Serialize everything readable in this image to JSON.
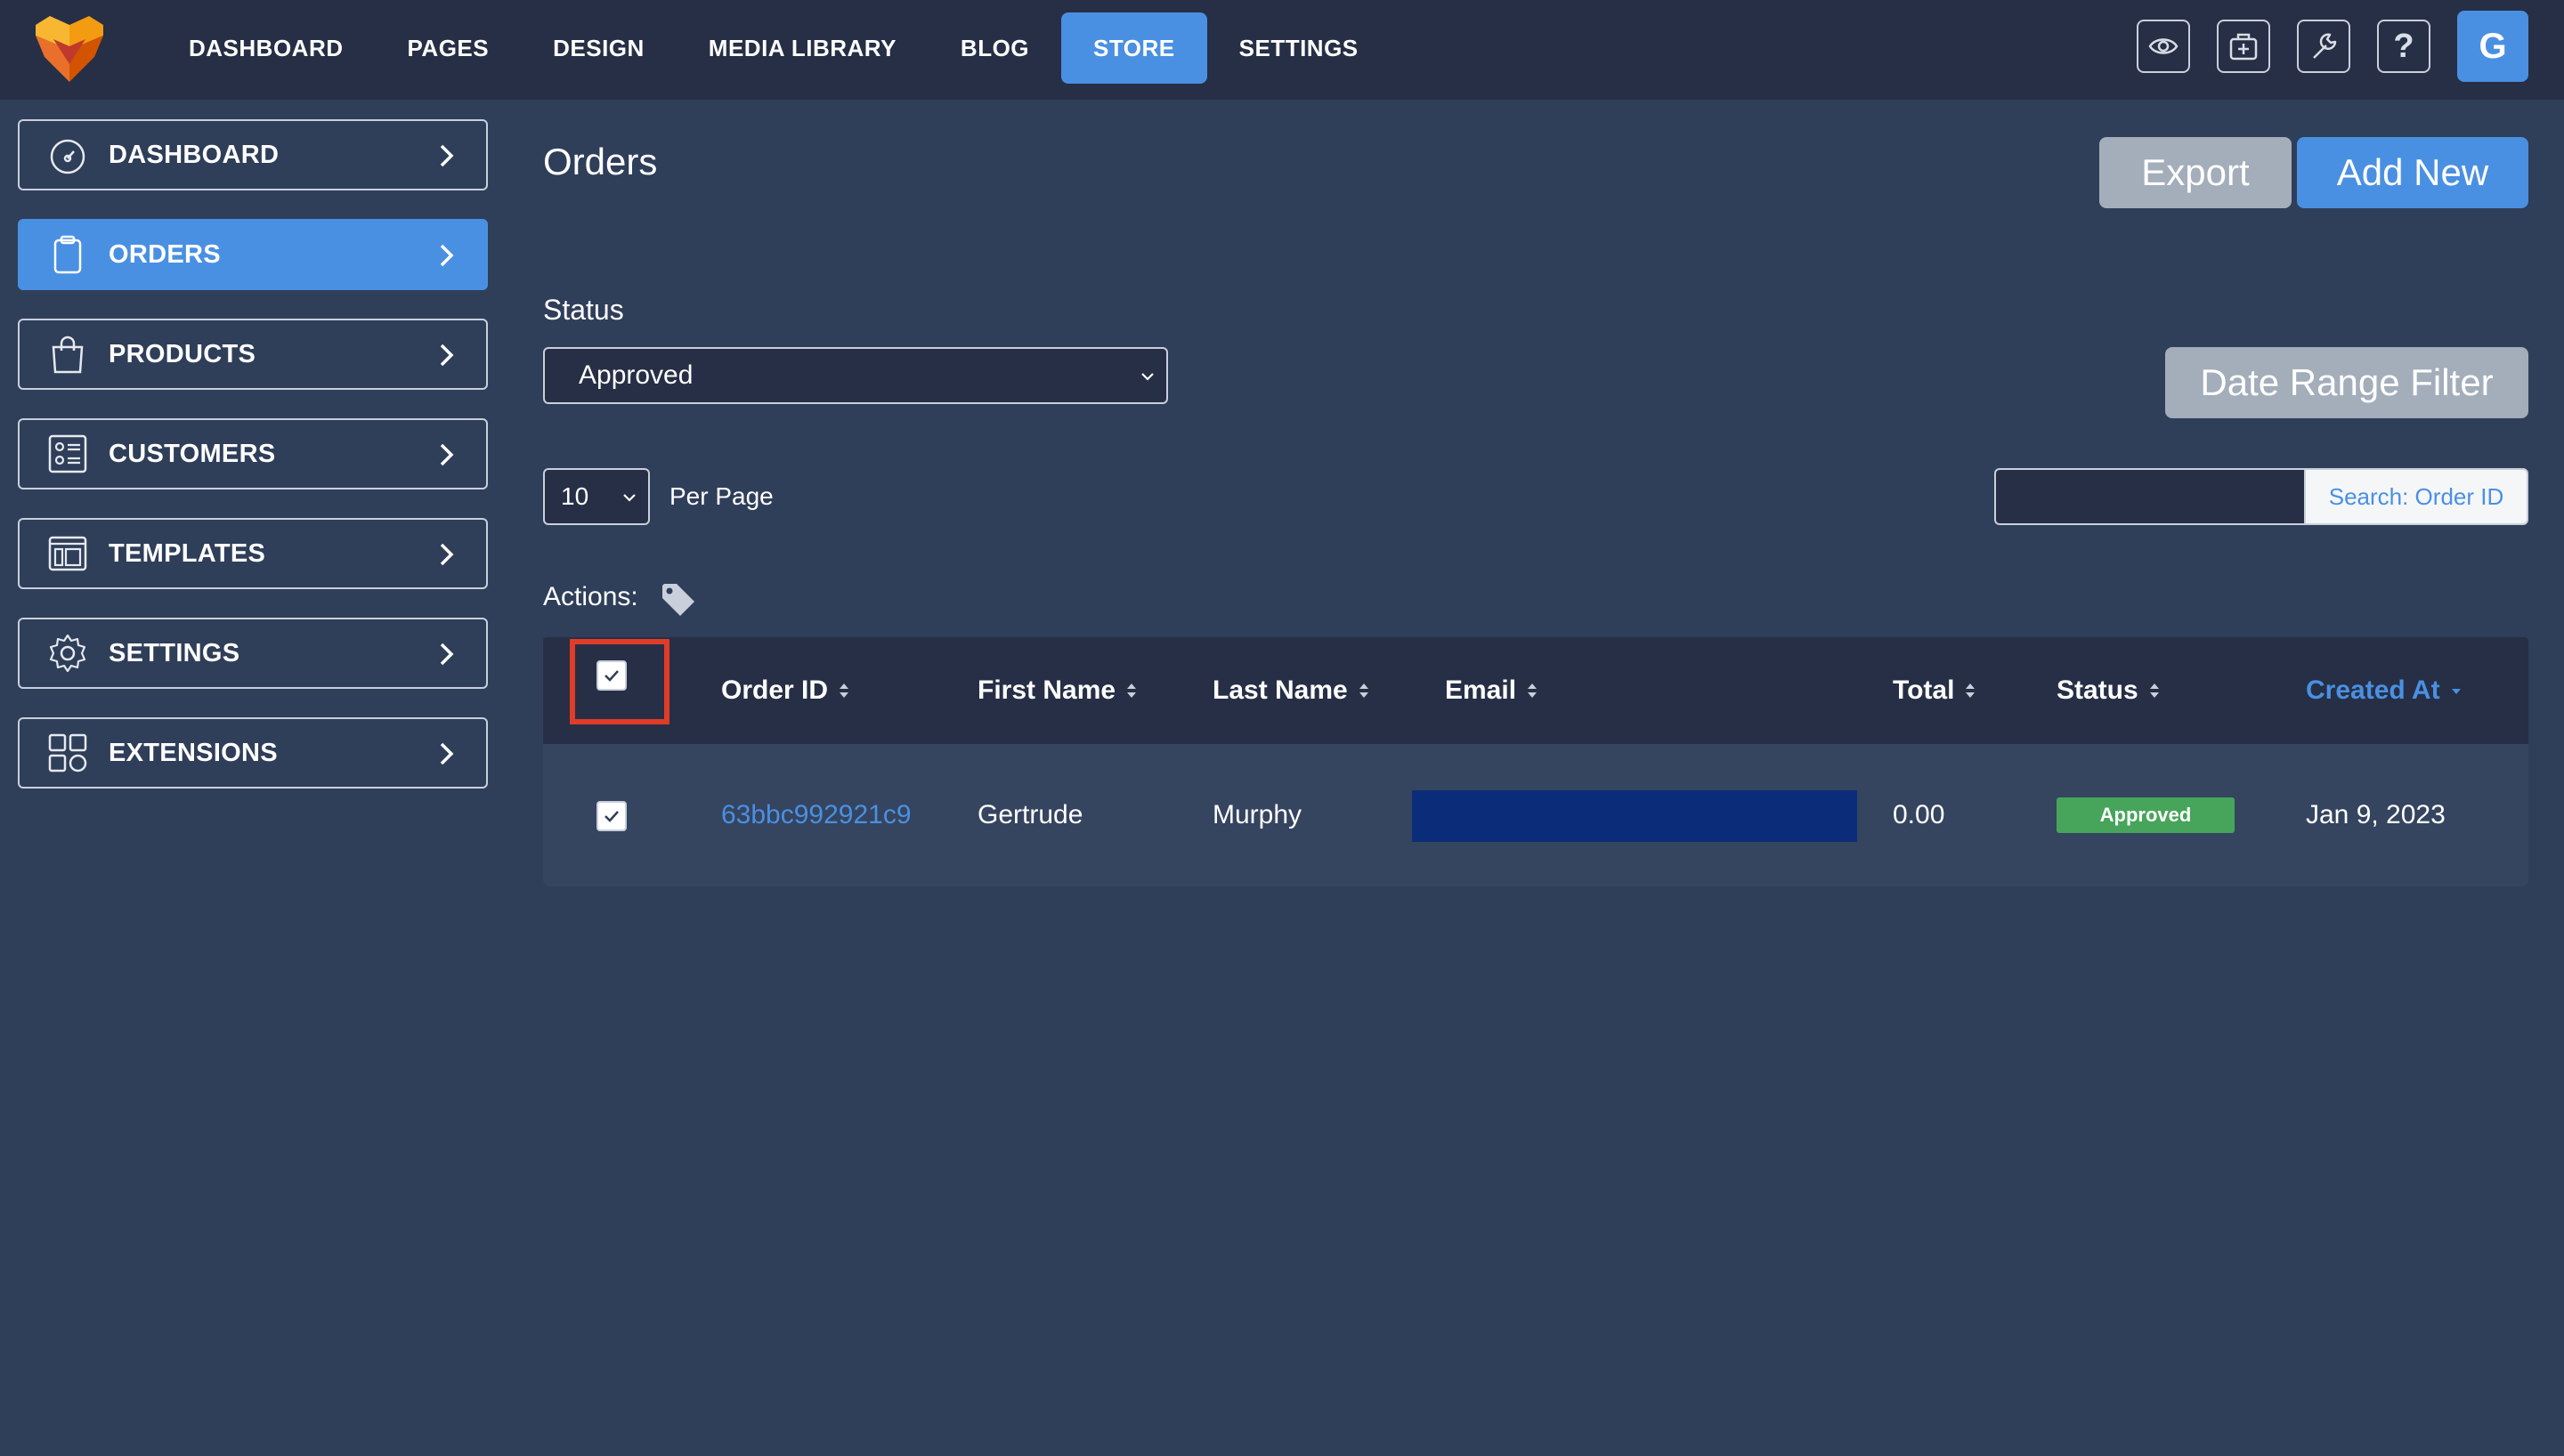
{
  "topnav": {
    "items": [
      {
        "label": "DASHBOARD",
        "active": false
      },
      {
        "label": "PAGES",
        "active": false
      },
      {
        "label": "DESIGN",
        "active": false
      },
      {
        "label": "MEDIA LIBRARY",
        "active": false
      },
      {
        "label": "BLOG",
        "active": false
      },
      {
        "label": "STORE",
        "active": true
      },
      {
        "label": "SETTINGS",
        "active": false
      }
    ],
    "icons": [
      "eye-icon",
      "briefcase-icon",
      "wrench-icon",
      "help-icon"
    ],
    "help_glyph": "?",
    "avatar_letter": "G"
  },
  "sidebar": {
    "items": [
      {
        "label": "DASHBOARD",
        "icon": "gauge-icon",
        "active": false
      },
      {
        "label": "ORDERS",
        "icon": "clipboard-icon",
        "active": true
      },
      {
        "label": "PRODUCTS",
        "icon": "shopping-bag-icon",
        "active": false
      },
      {
        "label": "CUSTOMERS",
        "icon": "contact-card-icon",
        "active": false
      },
      {
        "label": "TEMPLATES",
        "icon": "template-icon",
        "active": false
      },
      {
        "label": "SETTINGS",
        "icon": "gear-icon",
        "active": false
      },
      {
        "label": "EXTENSIONS",
        "icon": "grid-icon",
        "active": false
      }
    ]
  },
  "main": {
    "title": "Orders",
    "export_label": "Export",
    "add_new_label": "Add New",
    "status_label": "Status",
    "status_value": "Approved",
    "date_range_label": "Date Range Filter",
    "per_page_value": "10",
    "per_page_label": "Per Page",
    "search_value": "",
    "search_button": "Search: Order ID",
    "actions_label": "Actions:"
  },
  "table": {
    "headers": {
      "order_id": "Order ID",
      "first_name": "First Name",
      "last_name": "Last Name",
      "email": "Email",
      "total": "Total",
      "status": "Status",
      "created_at": "Created At"
    },
    "sorted_column": "created_at",
    "rows": [
      {
        "checked": true,
        "order_id": "63bbc992921c9",
        "first_name": "Gertrude",
        "last_name": "Murphy",
        "email": "",
        "total": "0.00",
        "status": "Approved",
        "created_at": "Jan 9, 2023"
      }
    ]
  },
  "colors": {
    "accent": "#4a90e2",
    "background": "#2f3e59",
    "topbar": "#262f45",
    "status_approved": "#46a55a",
    "highlight": "#e03c28"
  }
}
